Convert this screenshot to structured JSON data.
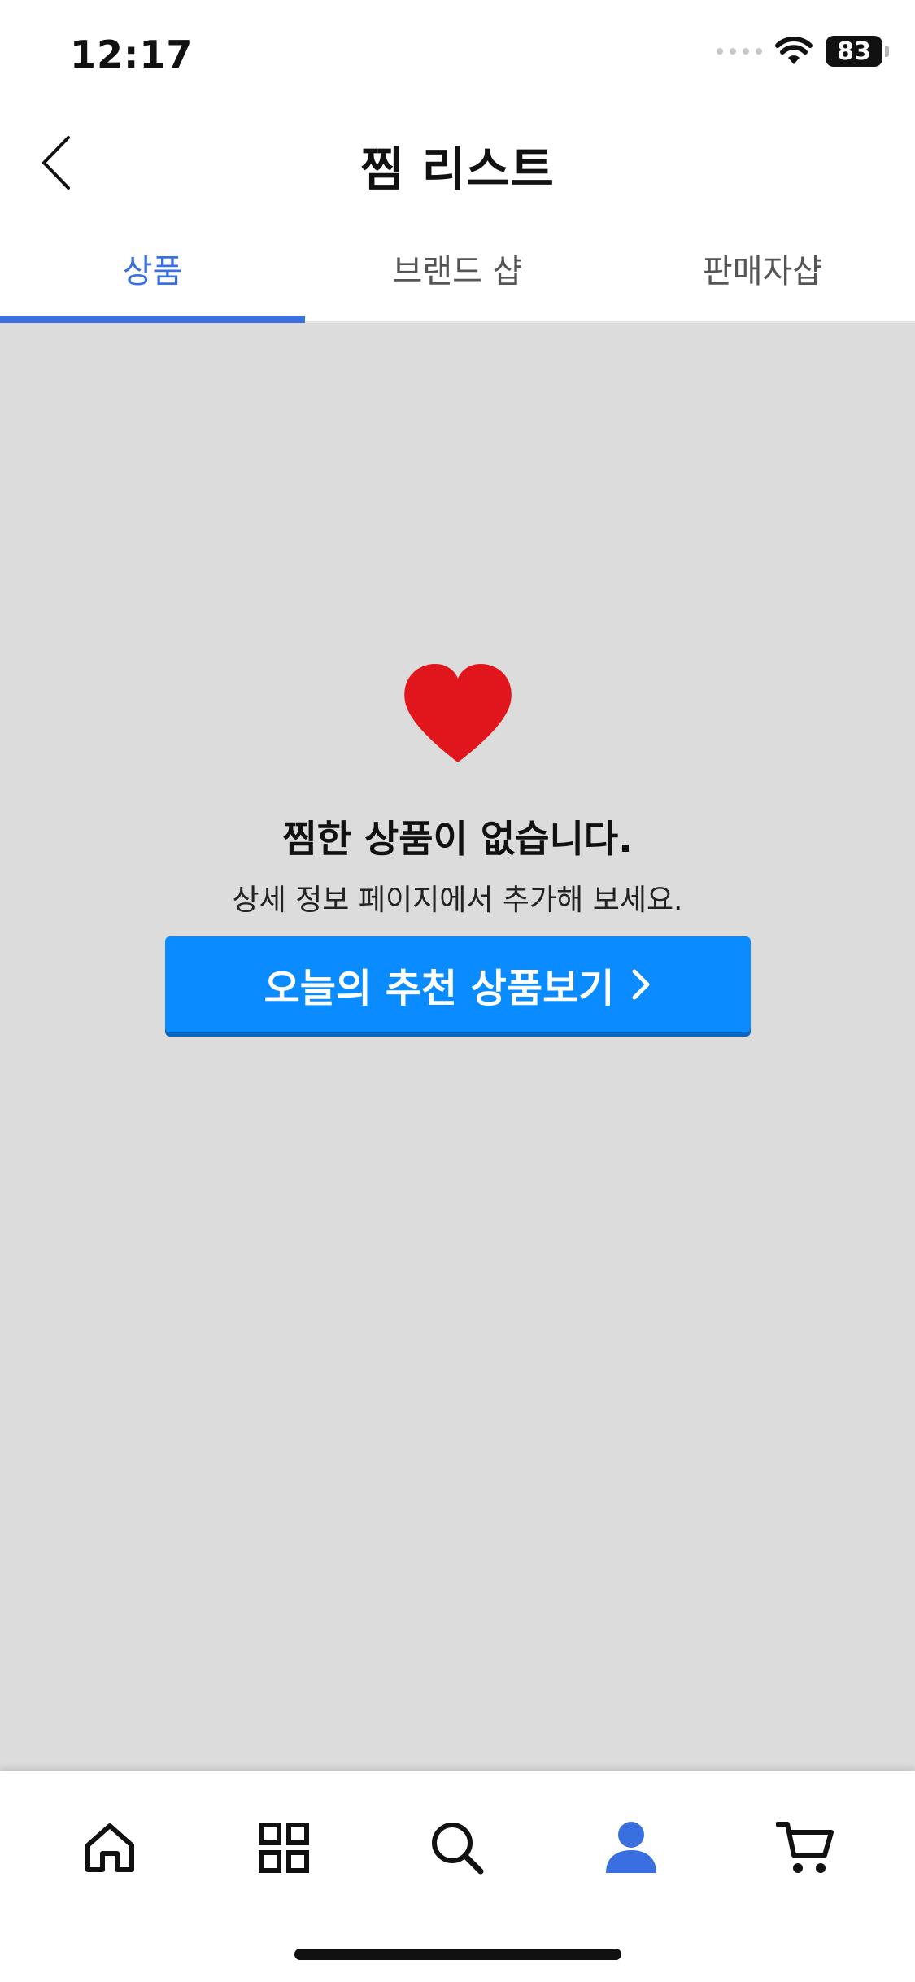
{
  "status_bar": {
    "time": "12:17",
    "battery": "83"
  },
  "header": {
    "title": "찜 리스트"
  },
  "tabs": [
    {
      "label": "상품",
      "active": true
    },
    {
      "label": "브랜드 샵",
      "active": false
    },
    {
      "label": "판매자샵",
      "active": false
    }
  ],
  "empty_state": {
    "title": "찜한 상품이 없습니다.",
    "subtitle": "상세 정보 페이지에서 추가해 보세요.",
    "cta_label": "오늘의 추천 상품보기"
  },
  "bottom_nav": {
    "items": [
      {
        "icon": "home-icon",
        "active": false
      },
      {
        "icon": "grid-icon",
        "active": false
      },
      {
        "icon": "search-icon",
        "active": false
      },
      {
        "icon": "person-icon",
        "active": true
      },
      {
        "icon": "cart-icon",
        "active": false
      }
    ]
  },
  "colors": {
    "accent": "#3a6fe0",
    "cta": "#0a8bff",
    "heart": "#e0161c",
    "content_bg": "#dcdcdc"
  }
}
